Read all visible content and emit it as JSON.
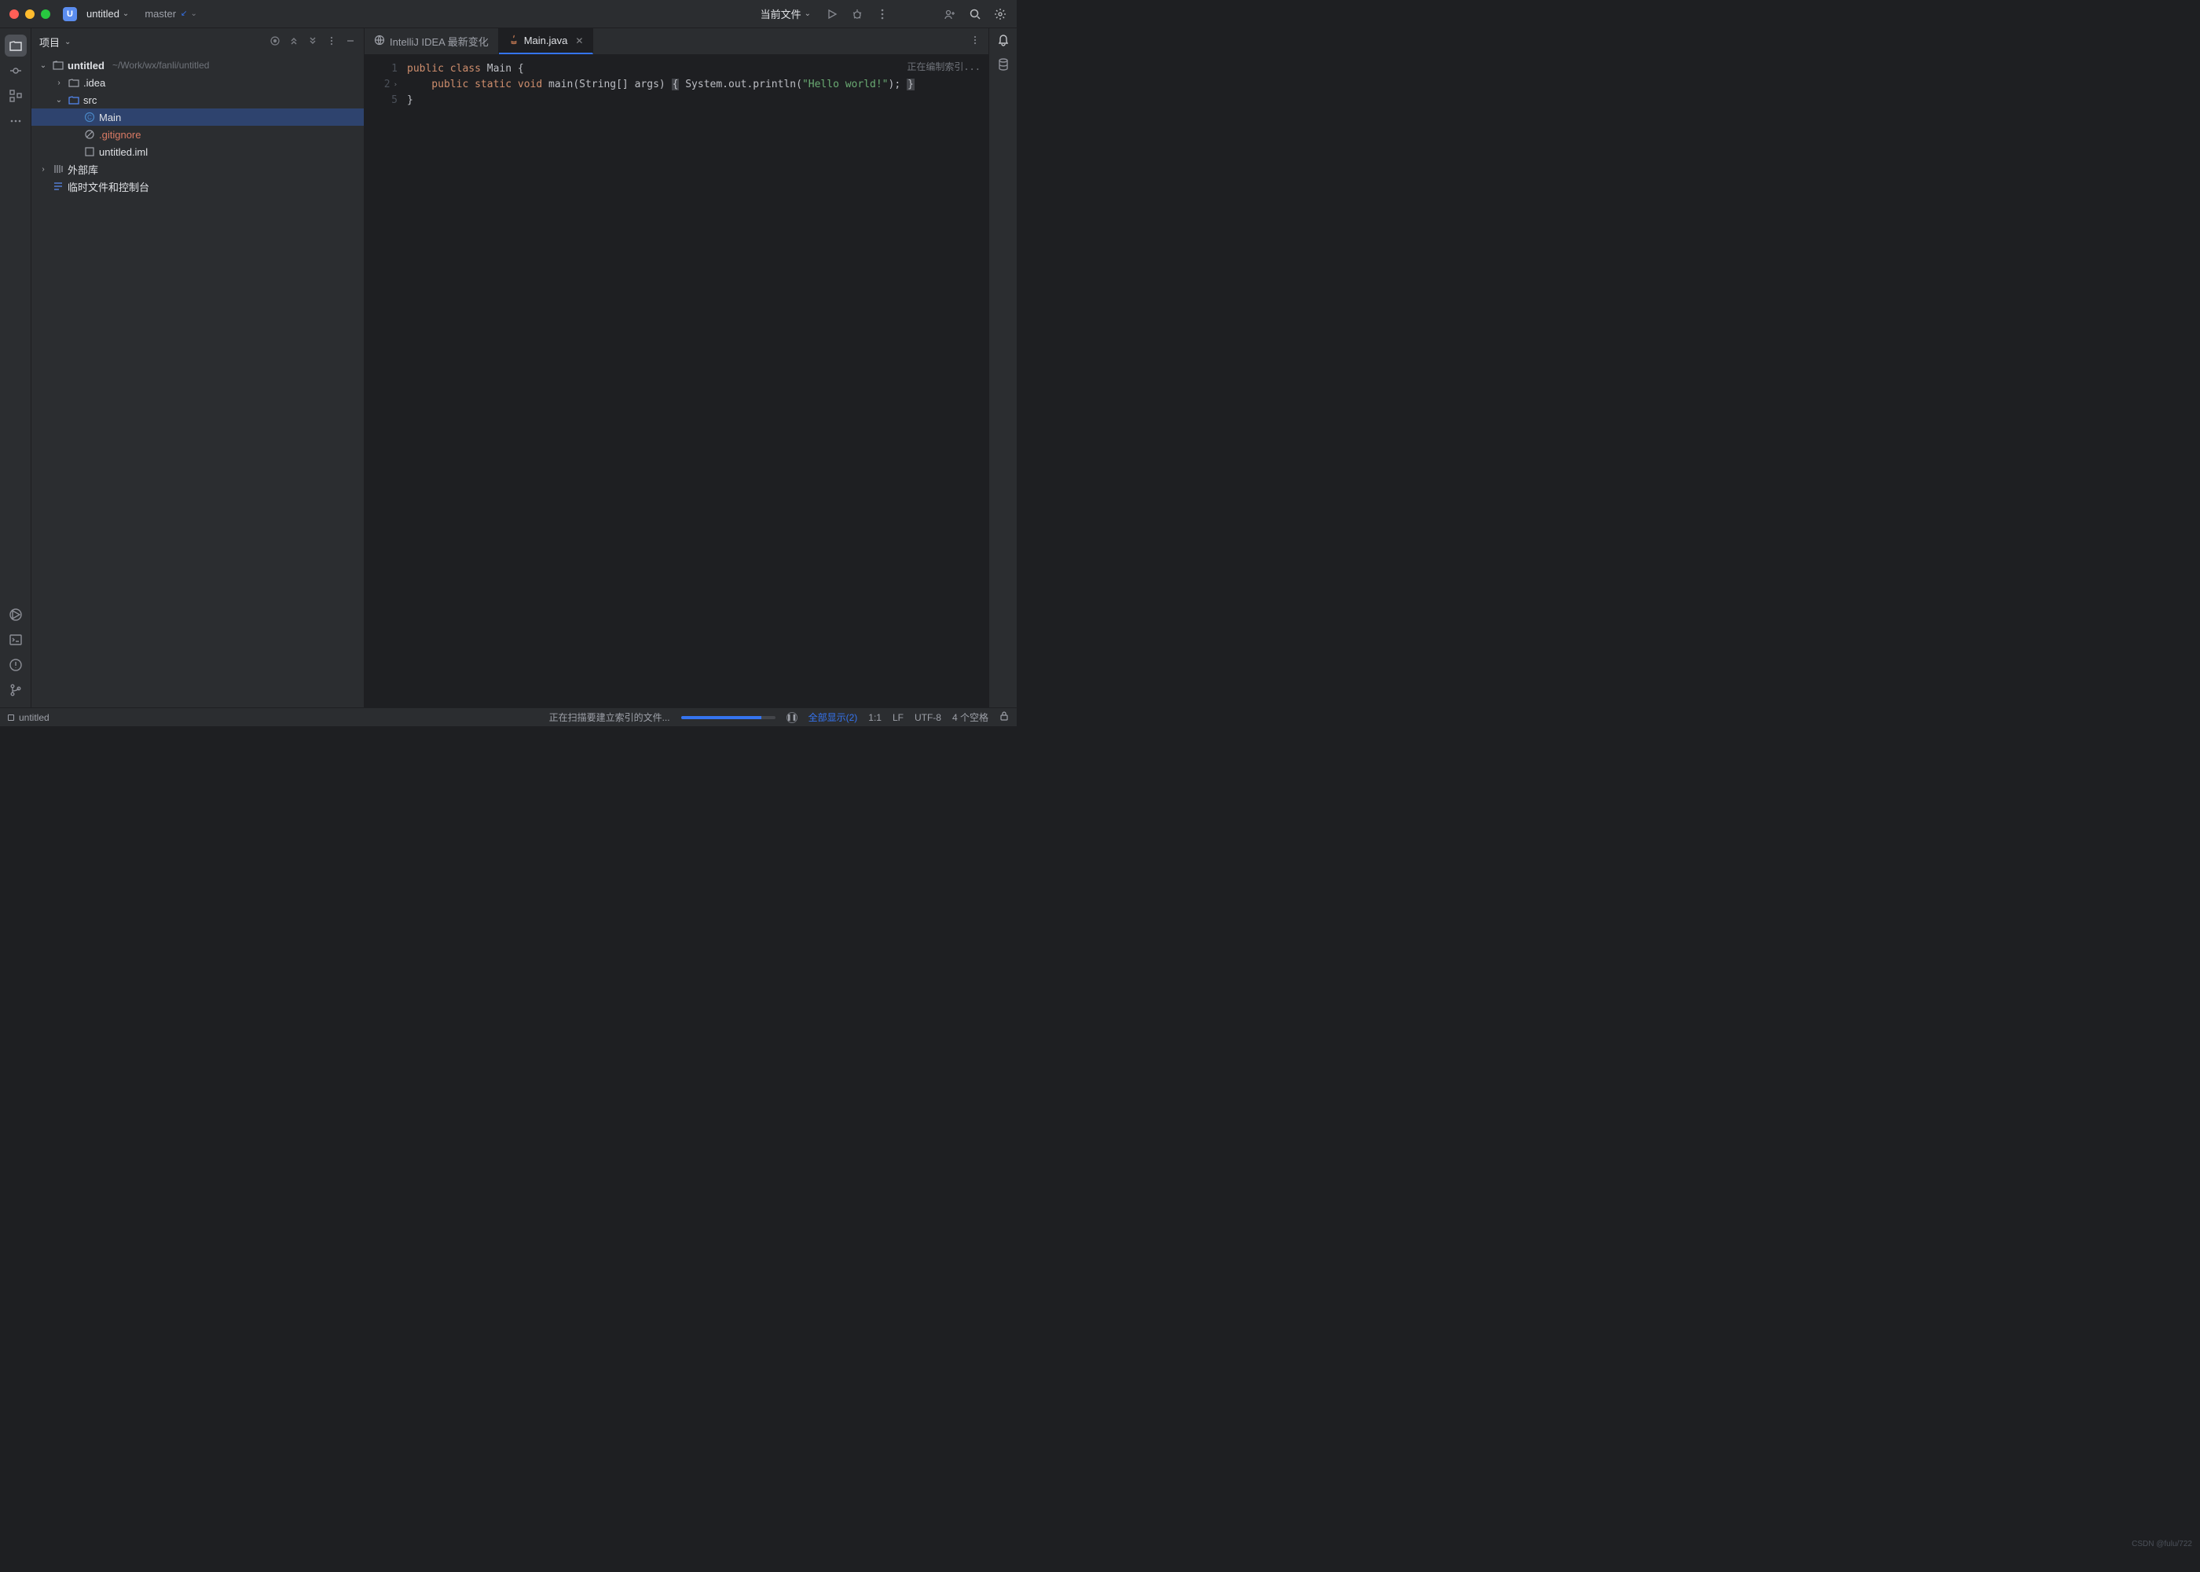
{
  "titlebar": {
    "project_badge": "U",
    "project_name": "untitled",
    "branch": "master",
    "run_target": "当前文件"
  },
  "sidebar": {
    "title": "项目",
    "root": {
      "name": "untitled",
      "path": "~/Work/wx/fanli/untitled"
    },
    "items": {
      "idea": ".idea",
      "src": "src",
      "main": "Main",
      "gitignore": ".gitignore",
      "iml": "untitled.iml",
      "extlib": "外部库",
      "scratch": "临时文件和控制台"
    }
  },
  "tabs": {
    "changes": "IntelliJ IDEA 最新变化",
    "main": "Main.java"
  },
  "editor": {
    "indexing": "正在编制索引...",
    "lines": {
      "l1_pre": "public class ",
      "l1_name": "Main {",
      "l2a": "    public static void ",
      "l2b": "main(String[] args) ",
      "l2c": "{",
      "l2d": " System.out.println(",
      "l2e": "\"Hello world!\"",
      "l2f": "); ",
      "l2g": "}",
      "l5": "}"
    },
    "gutter": {
      "n1": "1",
      "n2": "2",
      "n5": "5"
    }
  },
  "status": {
    "breadcrumb": "untitled",
    "scanning": "正在扫描要建立索引的文件...",
    "show_all": "全部显示(2)",
    "pos": "1:1",
    "line_sep": "LF",
    "encoding": "UTF-8",
    "indent": "4 个空格"
  },
  "watermark": "CSDN @fulu/722"
}
